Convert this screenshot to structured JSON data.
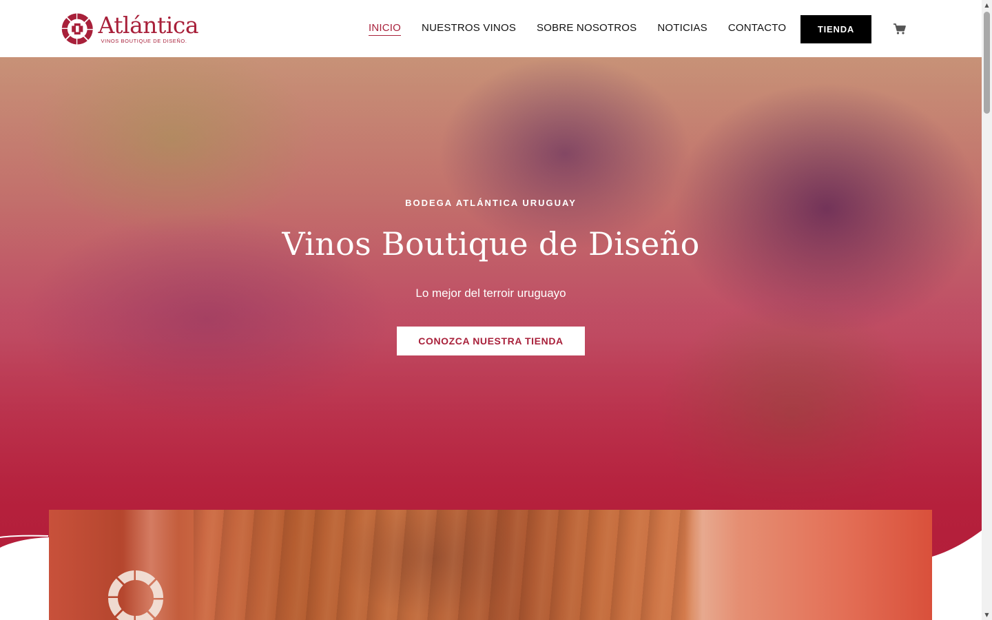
{
  "brand": {
    "name": "Atlántica",
    "tagline": "VINOS BOUTIQUE DE DISEÑO.",
    "color": "#a8203a"
  },
  "nav": {
    "items": [
      {
        "label": "INICIO",
        "active": true
      },
      {
        "label": "NUESTROS VINOS",
        "active": false
      },
      {
        "label": "SOBRE NOSOTROS",
        "active": false
      },
      {
        "label": "NOTICIAS",
        "active": false
      },
      {
        "label": "CONTACTO",
        "active": false
      }
    ],
    "shop_button": "TIENDA",
    "cart_icon": "shopping-cart-icon"
  },
  "hero": {
    "eyebrow": "BODEGA ATLÁNTICA URUGUAY",
    "title": "Vinos Boutique de Diseño",
    "subtitle": "Lo mejor del terroir uruguayo",
    "cta": "CONOZCA NUESTRA TIENDA",
    "overlay_color": "#b7233f"
  },
  "scrollbar": {
    "up_icon": "scroll-up-arrow-icon",
    "down_icon": "scroll-down-arrow-icon"
  }
}
